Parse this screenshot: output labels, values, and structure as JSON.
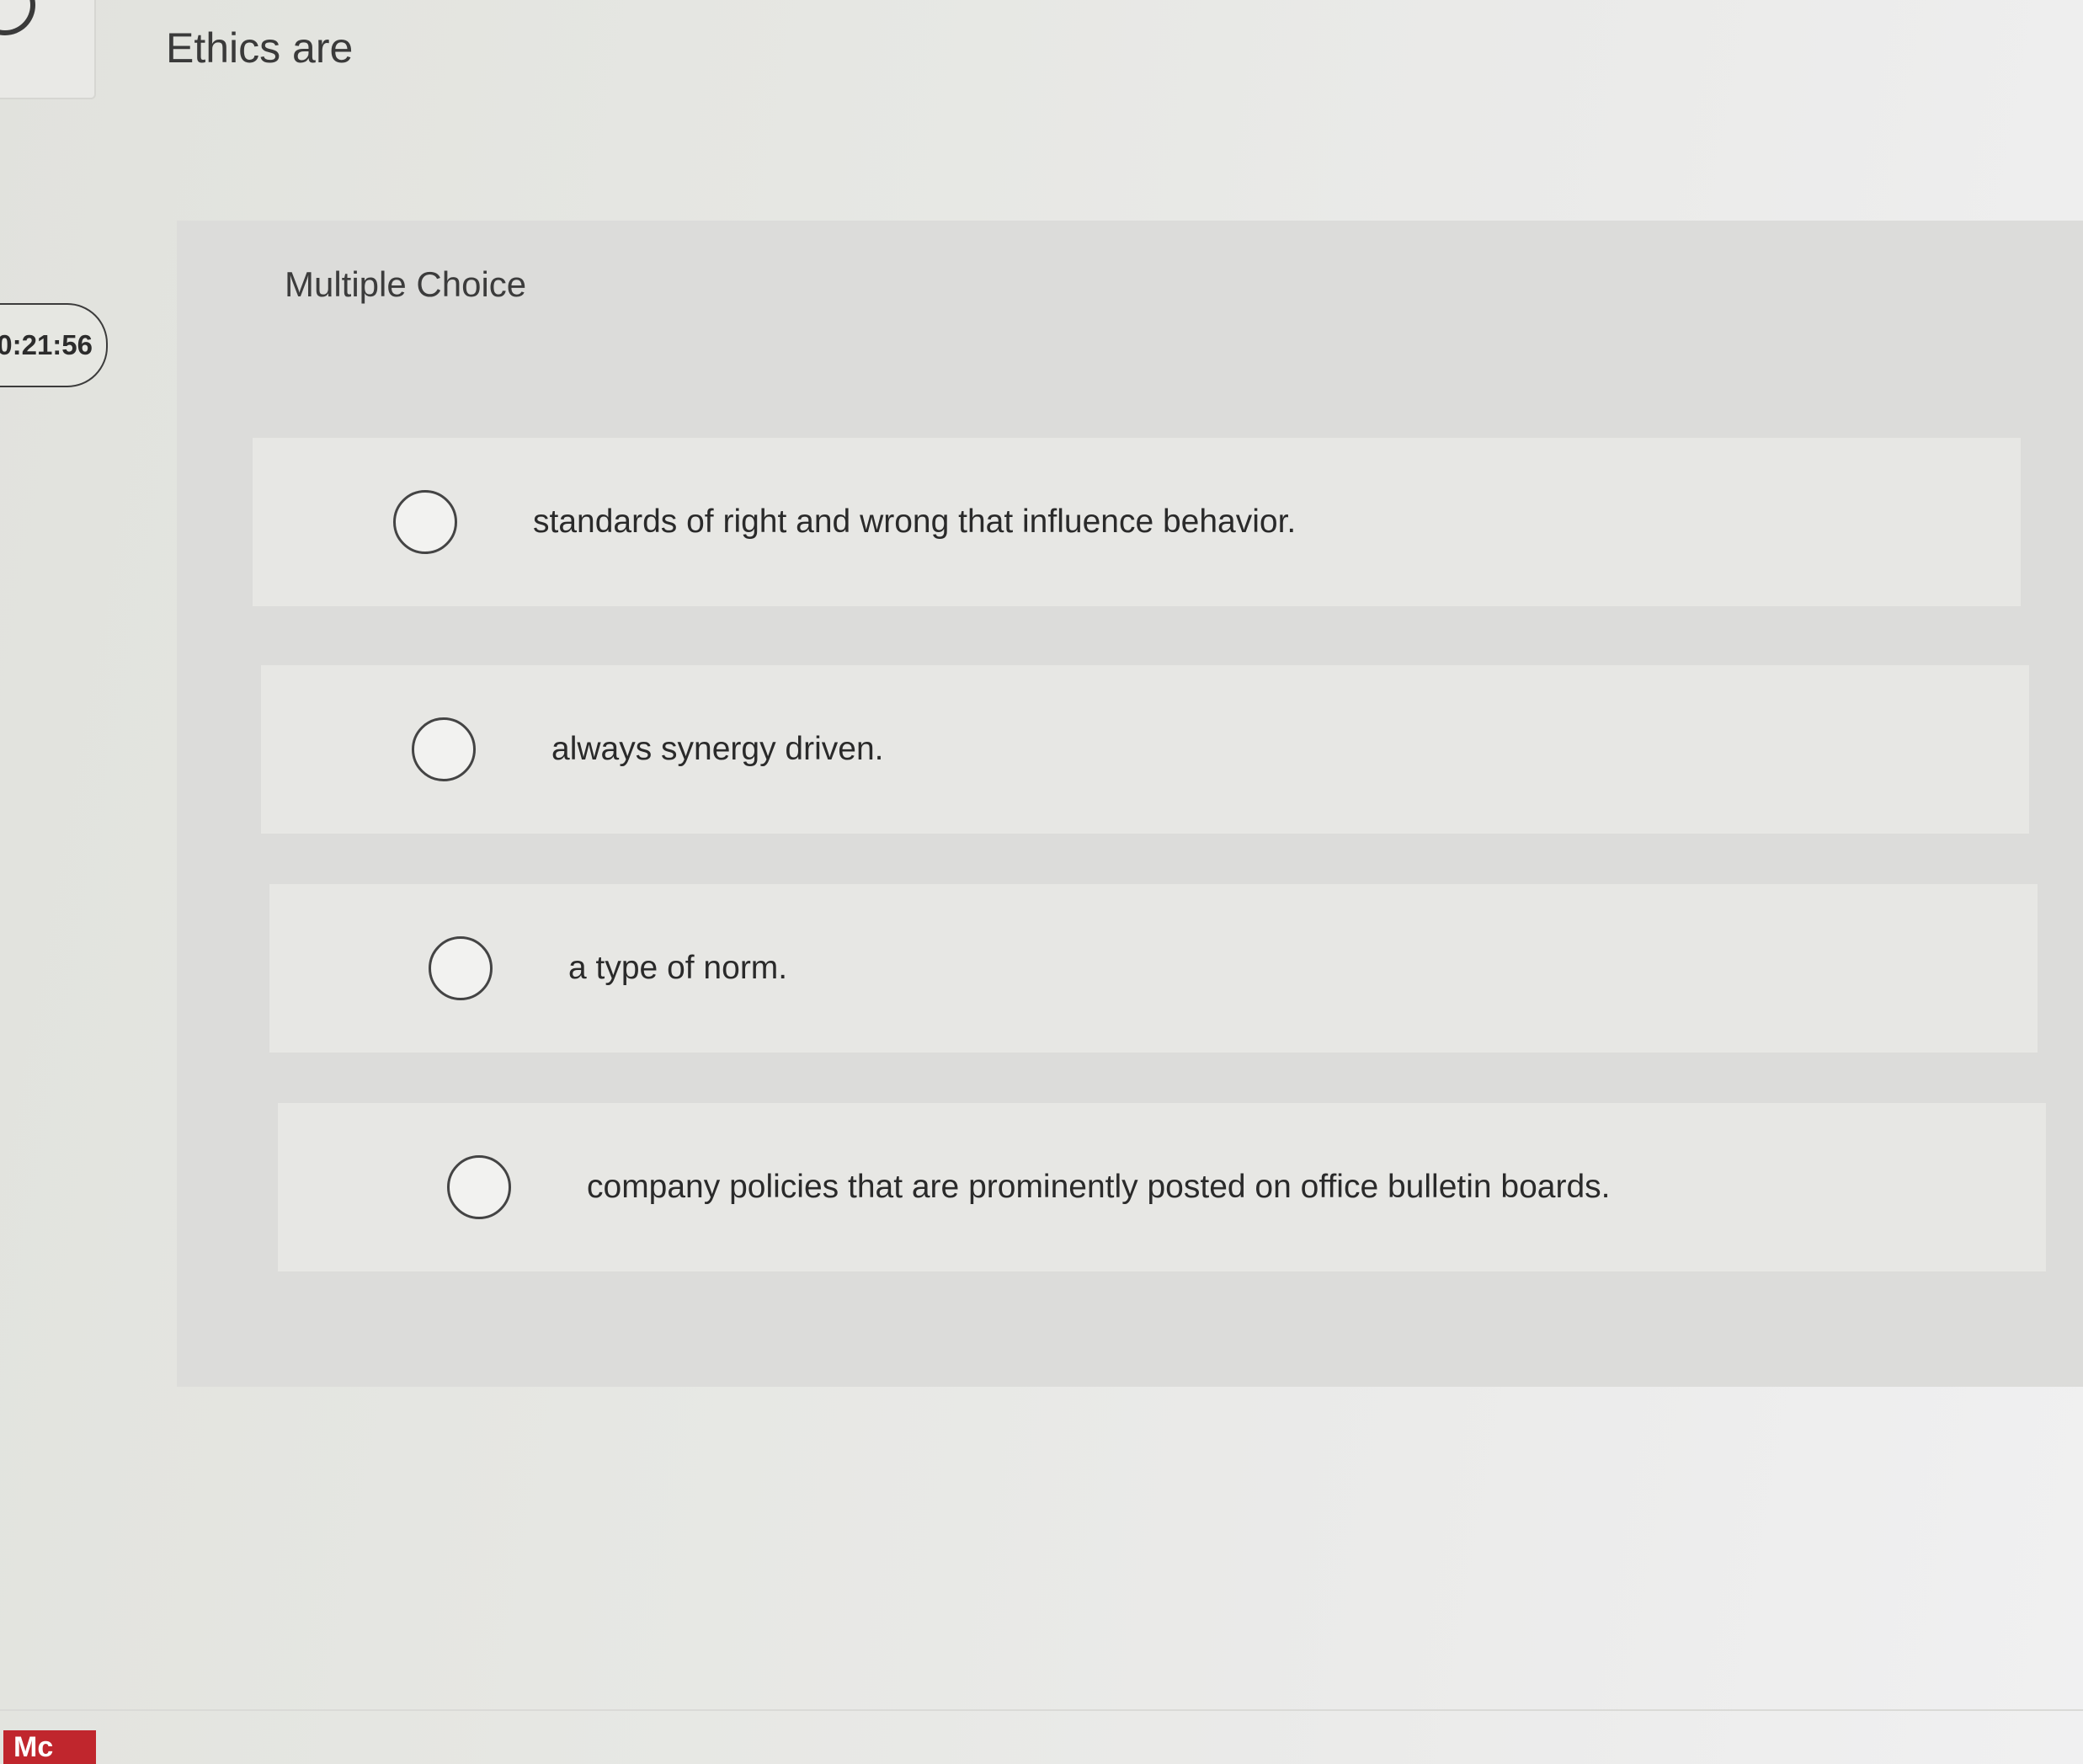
{
  "question": {
    "title": "Ethics are",
    "type_label": "Multiple Choice"
  },
  "timer": {
    "value": "0:21:56"
  },
  "options": [
    {
      "label": "standards of right and wrong that influence behavior."
    },
    {
      "label": "always synergy driven."
    },
    {
      "label": "a type of norm."
    },
    {
      "label": "company policies that are prominently posted on office bulletin boards."
    }
  ],
  "footer": {
    "logo_text": "Mc"
  }
}
